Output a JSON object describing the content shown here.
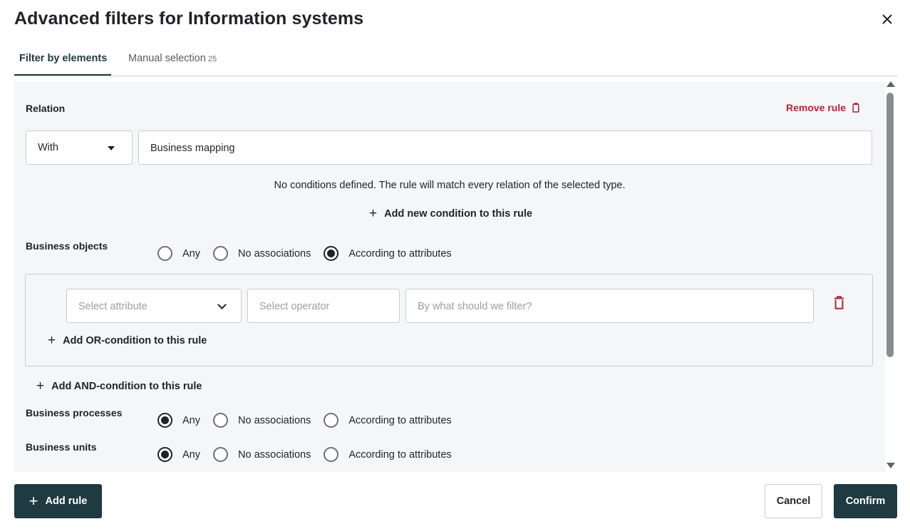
{
  "dialog": {
    "title": "Advanced filters for Information systems"
  },
  "tabs": [
    {
      "label": "Filter by elements",
      "active": true
    },
    {
      "label": "Manual selection",
      "count": "25",
      "active": false
    }
  ],
  "rule": {
    "section_label": "Relation",
    "remove_label": "Remove rule",
    "relation_select": "With",
    "relation_type": "Business mapping",
    "no_conditions_note": "No conditions defined. The rule will match every relation of the selected type.",
    "add_condition_label": "Add new condition to this rule"
  },
  "radio_labels": {
    "any": "Any",
    "no_assoc": "No associations",
    "by_attr": "According to attributes"
  },
  "groups": [
    {
      "label": "Business objects",
      "selected": "by_attr"
    },
    {
      "label": "Business processes",
      "selected": "any"
    },
    {
      "label": "Business units",
      "selected": "any"
    }
  ],
  "condition": {
    "attribute_placeholder": "Select attribute",
    "operator_placeholder": "Select operator",
    "value_placeholder": "By what should we filter?",
    "add_or_label": "Add OR-condition to this rule"
  },
  "add_and_label": "Add AND-condition to this rule",
  "footer": {
    "add_rule": "Add rule",
    "cancel": "Cancel",
    "confirm": "Confirm"
  },
  "colors": {
    "primary": "#1f3a40",
    "danger": "#b0263c",
    "panel_bg": "#f5f6f7"
  }
}
